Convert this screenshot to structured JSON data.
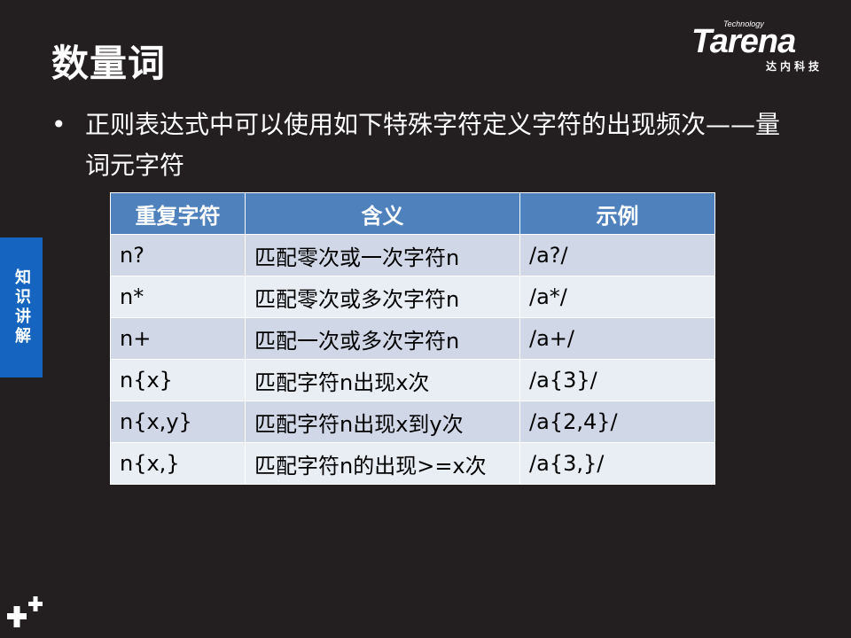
{
  "slide": {
    "title": "数量词",
    "bullet_text": "正则表达式中可以使用如下特殊字符定义字符的出现频次——量词元字符",
    "bullet_symbol": "•"
  },
  "logo": {
    "tagline": "Technology",
    "wordmark": "Tarena",
    "cn_name": "达内科技"
  },
  "side_tab": {
    "label": "知识讲解",
    "color": "#1565c0"
  },
  "table": {
    "headers": [
      "重复字符",
      "含义",
      "示例"
    ],
    "rows": [
      [
        "n?",
        "匹配零次或一次字符n",
        "/a?/"
      ],
      [
        "n*",
        "匹配零次或多次字符n",
        "/a*/"
      ],
      [
        "n+",
        "匹配一次或多次字符n",
        "/a+/"
      ],
      [
        "n{x}",
        "匹配字符n出现x次",
        "/a{3}/"
      ],
      [
        "n{x,y}",
        "匹配字符n出现x到y次",
        "/a{2,4}/"
      ],
      [
        "n{x,}",
        "匹配字符n的出现>=x次",
        "/a{3,}/"
      ]
    ],
    "header_color": "#4f81bd",
    "row_color_odd": "#d0d8e8",
    "row_color_even": "#e9edf4"
  },
  "colors": {
    "background": "#231f20",
    "text": "#ffffff"
  },
  "icons": {
    "corner": "plus-cluster-icon"
  }
}
